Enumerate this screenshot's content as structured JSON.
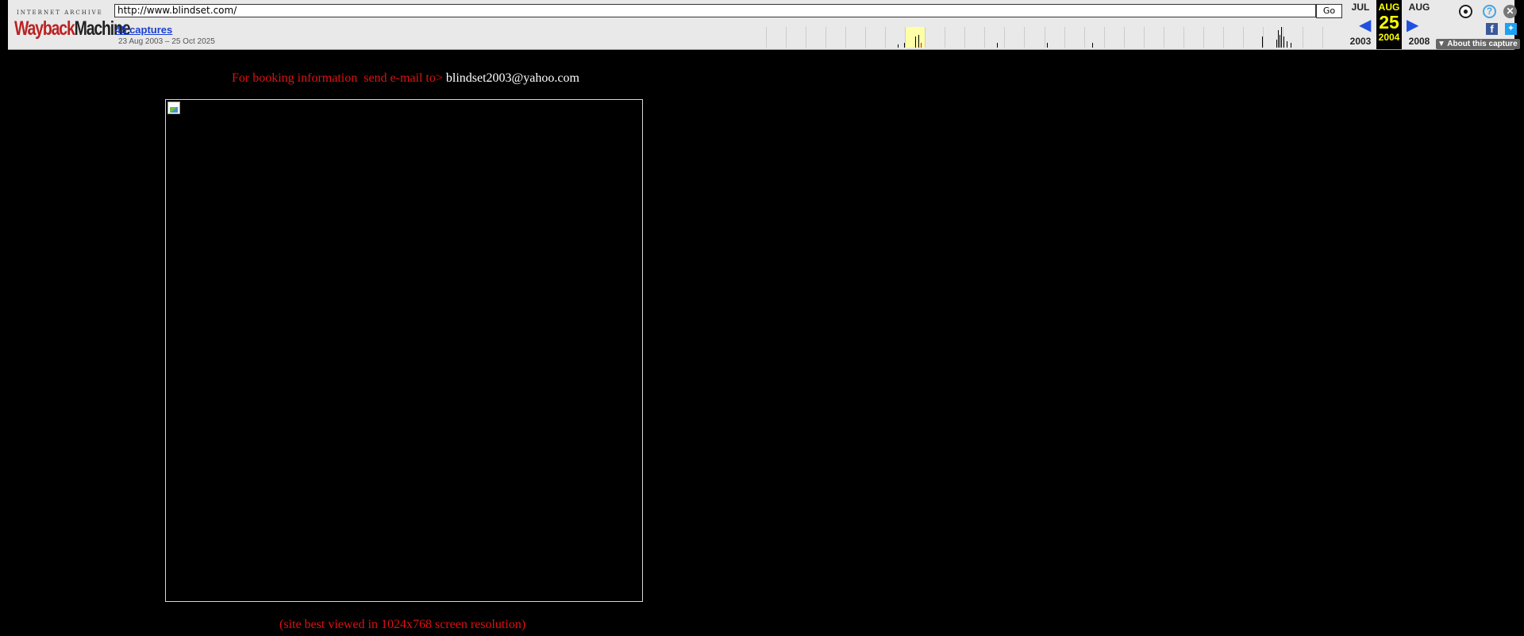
{
  "toolbar": {
    "logo_small": "INTERNET ARCHIVE",
    "logo_wayback": "Wayback",
    "logo_machine": "Machine",
    "url_value": "http://www.blindset.com/",
    "go_label": "Go",
    "captures_label": "45 captures",
    "capture_range": "23 Aug 2003 – 25 Oct 2025",
    "prev": {
      "month": "JUL",
      "year": "2003"
    },
    "current": {
      "month": "AUG",
      "day": "25",
      "year": "2004"
    },
    "next": {
      "month": "AUG",
      "year": "2008"
    },
    "about_label": "▼ About this capture",
    "icons": [
      "user-icon",
      "help-icon",
      "close-icon",
      "facebook-icon",
      "twitter-icon"
    ],
    "colors": {
      "current_highlight": "#ffff00",
      "arrow": "#2050e0"
    }
  },
  "page": {
    "booking_text": "For booking information  send e-mail to> ",
    "booking_email": "blindset2003@yahoo.com",
    "resolution_note": "(site best viewed in 1024x768 screen resolution)",
    "colors": {
      "text": "#e01010",
      "background": "#000000"
    }
  }
}
